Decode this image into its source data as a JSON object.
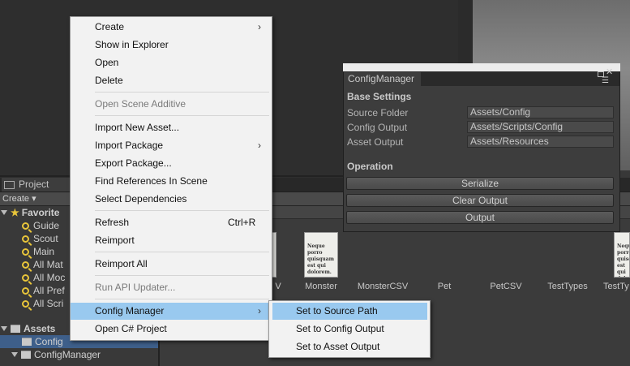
{
  "context_menu": {
    "items": [
      {
        "label": "Create",
        "submenu": true
      },
      {
        "label": "Show in Explorer"
      },
      {
        "label": "Open"
      },
      {
        "label": "Delete"
      },
      {
        "label": "Open Scene Additive",
        "disabled": true
      },
      {
        "label": "Import New Asset..."
      },
      {
        "label": "Import Package",
        "submenu": true
      },
      {
        "label": "Export Package..."
      },
      {
        "label": "Find References In Scene"
      },
      {
        "label": "Select Dependencies"
      },
      {
        "label": "Refresh",
        "shortcut": "Ctrl+R"
      },
      {
        "label": "Reimport"
      },
      {
        "label": "Reimport All"
      },
      {
        "label": "Run API Updater...",
        "disabled": true
      },
      {
        "label": "Config Manager",
        "submenu": true,
        "highlighted": true
      },
      {
        "label": "Open C# Project"
      }
    ],
    "highlight_color": "#99c9ef"
  },
  "submenu": {
    "items": [
      {
        "label": "Set to Source Path",
        "highlighted": true
      },
      {
        "label": "Set to Config Output"
      },
      {
        "label": "Set to Asset Output"
      }
    ]
  },
  "config_window": {
    "tab": "ConfigManager",
    "base_settings_title": "Base Settings",
    "fields": [
      {
        "label": "Source Folder",
        "value": "Assets/Config"
      },
      {
        "label": "Config Output",
        "value": "Assets/Scripts/Config"
      },
      {
        "label": "Asset Output",
        "value": "Assets/Resources"
      }
    ],
    "operation_title": "Operation",
    "buttons": [
      "Serialize",
      "Clear Output",
      "Output"
    ]
  },
  "project_panel": {
    "tab": "Project",
    "create_label": "Create ▾",
    "favorites_label": "Favorite",
    "favorites": [
      "Guide",
      "Scout",
      "Main",
      "All Mat",
      "All Moc",
      "All Pref",
      "All Scri"
    ],
    "assets_label": "Assets",
    "assets_children": [
      "Config",
      "ConfigManager"
    ],
    "selected_folder": "Config"
  },
  "assets": {
    "labels": [
      "V",
      "Monster",
      "MonsterCSV",
      "Pet",
      "PetCSV",
      "TestTypes",
      "TestTy"
    ],
    "thumb_text": "Neque porro quisquam est qui dolorem."
  }
}
